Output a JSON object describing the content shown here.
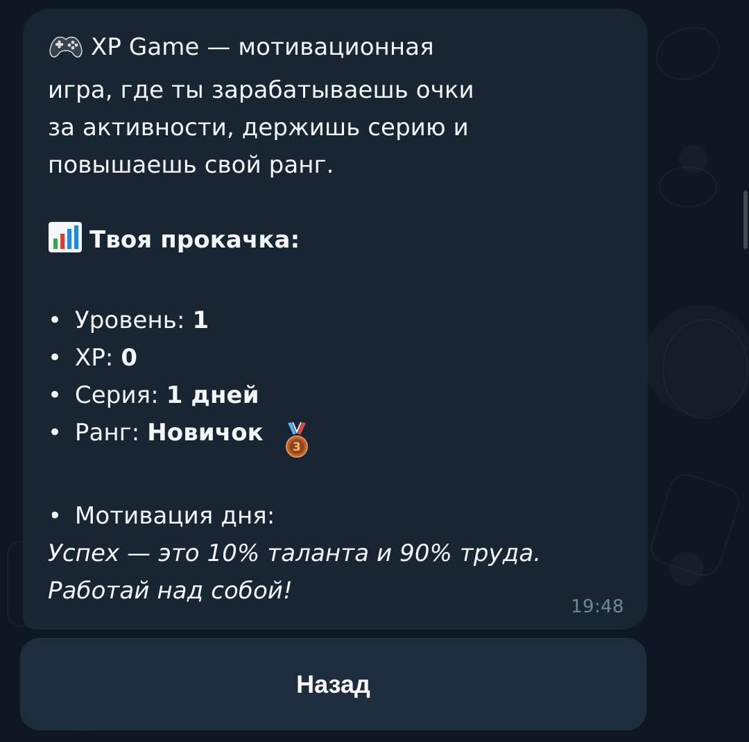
{
  "message": {
    "intro_lines": [
      "XP Game — мотивационная",
      "игра, где ты зарабатываешь очки",
      "за активности, держишь серию и",
      "повышаешь свой ранг."
    ],
    "progress_heading": "Твоя прокачка:",
    "stats": {
      "level_label": "Уровень:",
      "level_value": "1",
      "xp_label": "XP:",
      "xp_value": "0",
      "streak_label": "Серия:",
      "streak_value": "1 дней",
      "rank_label": "Ранг:",
      "rank_value": "Новичок"
    },
    "motivation_label": "Мотивация дня:",
    "motivation_quote_line1": "Успех — это 10% таланта и 90% труда.",
    "motivation_quote_line2": "Работай над собой!",
    "timestamp": "19:48"
  },
  "icons": {
    "intro": "game-controller-icon",
    "progress": "bar-chart-icon",
    "rank": "bronze-medal-icon"
  },
  "colors": {
    "background": "#0e1621",
    "bubble": "#182533",
    "button": "#203040",
    "timestamp": "#6f879b",
    "text": "#f4f6f8"
  },
  "buttons": {
    "back_label": "Назад"
  }
}
